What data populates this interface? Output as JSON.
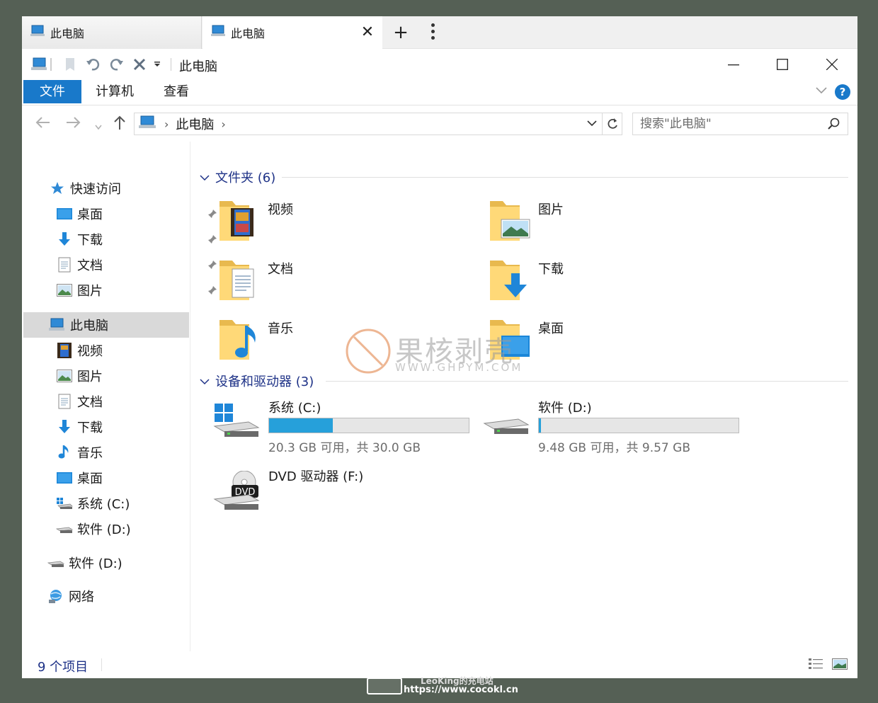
{
  "tabs": [
    {
      "label": "此电脑"
    },
    {
      "label": "此电脑"
    }
  ],
  "titlebar": {
    "title": "此电脑"
  },
  "ribbon": {
    "tabs": [
      "文件",
      "计算机",
      "查看"
    ],
    "help": "?"
  },
  "address": {
    "crumb": "此电脑"
  },
  "search": {
    "placeholder": "搜索\"此电脑\""
  },
  "nav": {
    "quick_access": "快速访问",
    "quick_items": [
      "桌面",
      "下载",
      "文档",
      "图片"
    ],
    "this_pc": "此电脑",
    "pc_items": [
      "视频",
      "图片",
      "文档",
      "下载",
      "音乐",
      "桌面",
      "系统 (C:)",
      "软件 (D:)"
    ],
    "drive_d": "软件 (D:)",
    "network": "网络"
  },
  "folders": {
    "heading": "文件夹 (6)",
    "items": [
      "视频",
      "图片",
      "文档",
      "下载",
      "音乐",
      "桌面"
    ]
  },
  "devices": {
    "heading": "设备和驱动器 (3)",
    "drives": [
      {
        "name": "系统 (C:)",
        "free": "20.3 GB 可用，共 30.0 GB",
        "used_fraction": 0.32
      },
      {
        "name": "软件 (D:)",
        "free": "9.48 GB 可用，共 9.57 GB",
        "used_fraction": 0.01
      }
    ],
    "dvd": {
      "name": "DVD 驱动器 (F:)",
      "badge": "DVD"
    }
  },
  "status": {
    "count": "9 个项目"
  },
  "watermark": {
    "title": "果核剥壳",
    "url": "WWW.GHPYM.COM"
  },
  "footer": {
    "title": "LeoKing的充电站",
    "url": "https://www.cocokl.cn"
  },
  "colors": {
    "accent": "#1979ca",
    "progress": "#26a0da",
    "link": "#1e3287"
  }
}
